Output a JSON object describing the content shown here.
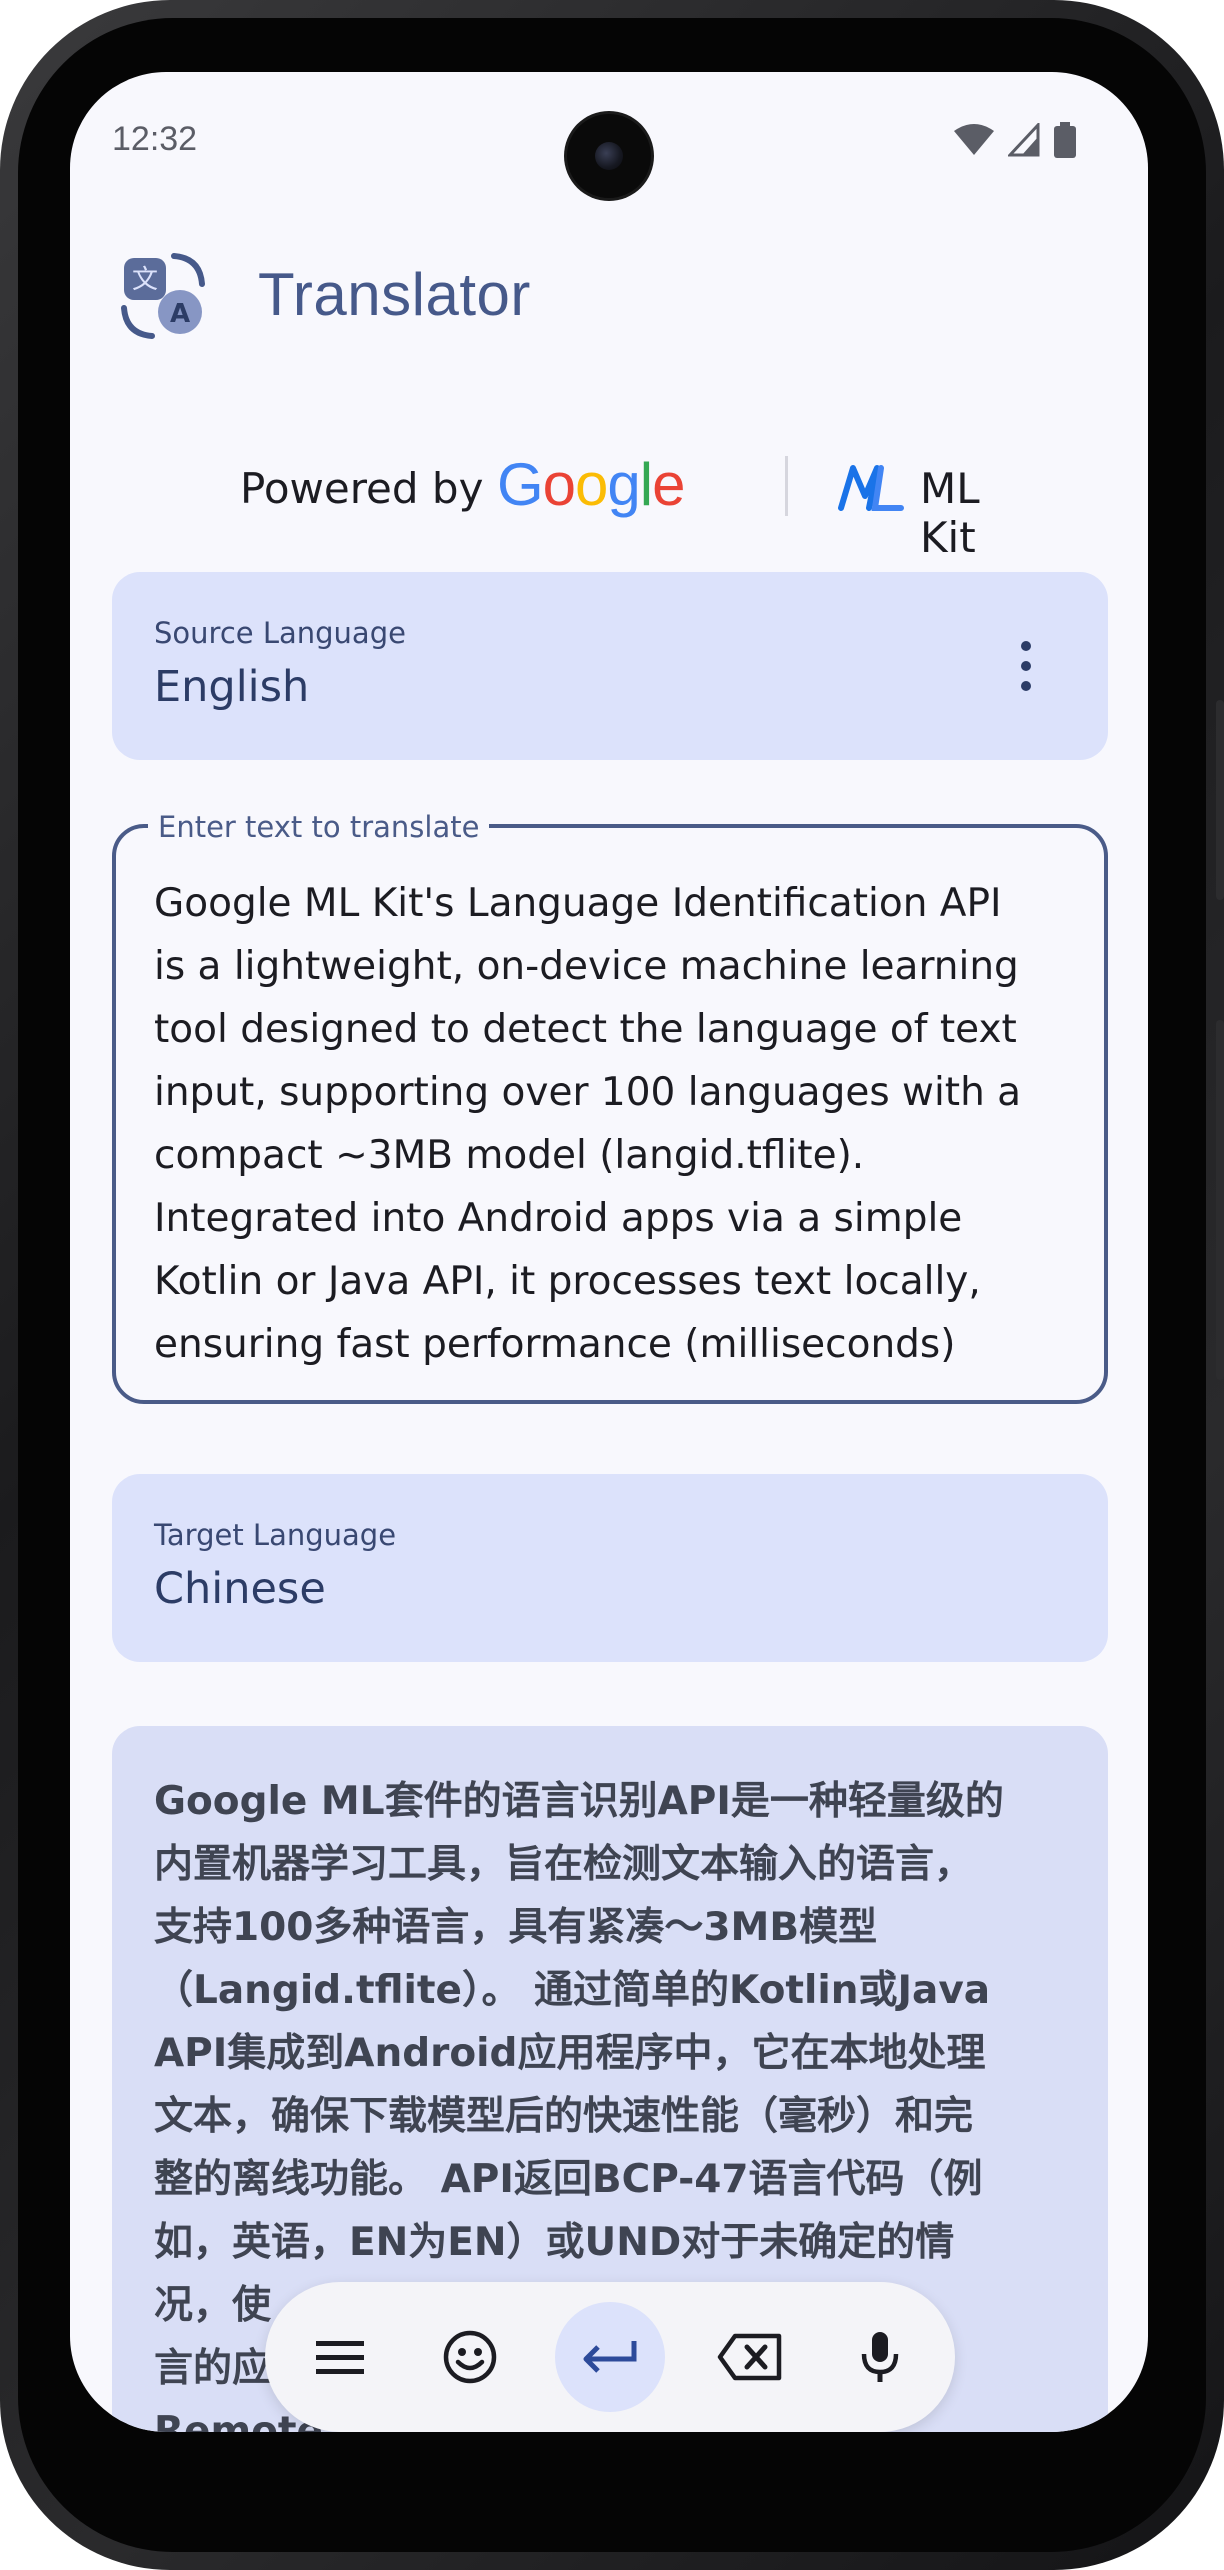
{
  "status_bar": {
    "time": "12:32"
  },
  "app": {
    "title": "Translator"
  },
  "powered_by": {
    "prefix": "Powered by",
    "google": [
      "G",
      "o",
      "o",
      "g",
      "l",
      "e"
    ],
    "mlkit": "ML Kit"
  },
  "source": {
    "label": "Source Language",
    "value": "English"
  },
  "input": {
    "label": "Enter text to translate",
    "lines": [
      "Google ML Kit's Language Identification API",
      "is a lightweight, on-device machine learning",
      "tool designed to detect the language of text",
      "input, supporting over 100 languages with a",
      "compact ~3MB model (langid.tflite).",
      "Integrated into Android apps via a simple",
      "Kotlin or Java API, it processes text locally,",
      "ensuring fast performance (milliseconds)"
    ]
  },
  "target": {
    "label": "Target Language",
    "value": "Chinese"
  },
  "result": {
    "lines": [
      "Google ML套件的语言识别API是一种轻量级的",
      "内置机器学习工具，旨在检测文本输入的语言，",
      "支持100多种语言，具有紧凑～3MB模型",
      "（Langid.tflite）。 通过简单的Kotlin或Java",
      "API集成到Android应用程序中，它在本地处理",
      "文本，确保下载模型后的快速性能（毫秒）和完",
      "整的离线功能。 API返回BCP-47语言代码（例",
      "如，英语，EN为EN）或UND对于未确定的情",
      "况，使                              识别语",
      "言的应",
      "Remote                              以简"
    ]
  },
  "keyboard_toolbar": {
    "items": [
      "menu-icon",
      "emoji-icon",
      "enter-icon",
      "backspace-icon",
      "microphone-icon"
    ]
  },
  "colors": {
    "accent": "#46598a",
    "card": "#dce2fb",
    "result_card": "#d9def6",
    "outline": "#4a5b88"
  }
}
